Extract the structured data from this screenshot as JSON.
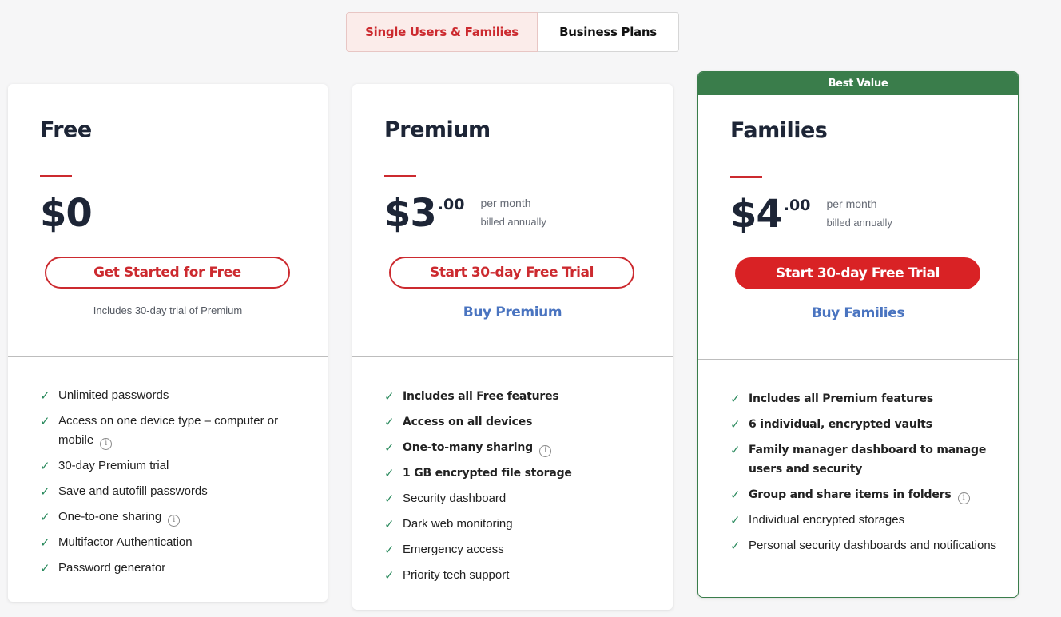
{
  "tabs": [
    {
      "label": "Single Users & Families",
      "active": true
    },
    {
      "label": "Business Plans",
      "active": false
    }
  ],
  "colors": {
    "accent_red": "#cc2a2f",
    "cta_red": "#d92225",
    "best_value_green": "#3a7d4b",
    "check_green": "#2a8a5d",
    "link_blue": "#4a74c0",
    "heading_navy": "#1d2536"
  },
  "plans": [
    {
      "name": "Free",
      "price": "$0",
      "cents": "",
      "period": "",
      "billing": "",
      "cta": "Get Started for Free",
      "note": "Includes 30-day trial of Premium",
      "features": [
        {
          "text": "Unlimited passwords",
          "bold": false,
          "info": false
        },
        {
          "text": "Access on one device type – computer or mobile",
          "bold": false,
          "info": true
        },
        {
          "text": "30-day Premium trial",
          "bold": false,
          "info": false
        },
        {
          "text": "Save and autofill passwords",
          "bold": false,
          "info": false
        },
        {
          "text": "One-to-one sharing",
          "bold": false,
          "info": true
        },
        {
          "text": "Multifactor Authentication",
          "bold": false,
          "info": false
        },
        {
          "text": "Password generator",
          "bold": false,
          "info": false
        }
      ]
    },
    {
      "name": "Premium",
      "price": "$3",
      "cents": ".00",
      "period": "per month",
      "billing": "billed annually",
      "cta": "Start 30-day Free Trial",
      "buy_link": "Buy Premium",
      "features": [
        {
          "text": "Includes all Free features",
          "bold": true,
          "info": false
        },
        {
          "text": "Access on all devices",
          "bold": true,
          "info": false
        },
        {
          "text": "One-to-many sharing",
          "bold": true,
          "info": true
        },
        {
          "text": "1 GB encrypted file storage",
          "bold": true,
          "info": false
        },
        {
          "text": "Security dashboard",
          "bold": false,
          "info": false
        },
        {
          "text": "Dark web monitoring",
          "bold": false,
          "info": false
        },
        {
          "text": "Emergency access",
          "bold": false,
          "info": false
        },
        {
          "text": "Priority tech support",
          "bold": false,
          "info": false
        }
      ]
    },
    {
      "name": "Families",
      "badge": "Best Value",
      "price": "$4",
      "cents": ".00",
      "period": "per month",
      "billing": "billed annually",
      "cta": "Start 30-day Free Trial",
      "buy_link": "Buy Families",
      "features": [
        {
          "text": "Includes all Premium features",
          "bold": true,
          "info": false
        },
        {
          "text": "6 individual, encrypted vaults",
          "bold": true,
          "info": false
        },
        {
          "text": "Family manager dashboard to manage users and security",
          "bold": true,
          "info": false
        },
        {
          "text": "Group and share items in folders",
          "bold": true,
          "info": true
        },
        {
          "text": "Individual encrypted storages",
          "bold": false,
          "info": false
        },
        {
          "text": "Personal security dashboards and notifications",
          "bold": false,
          "info": false
        }
      ]
    }
  ],
  "icons": {
    "check": "✓",
    "info": "i"
  }
}
